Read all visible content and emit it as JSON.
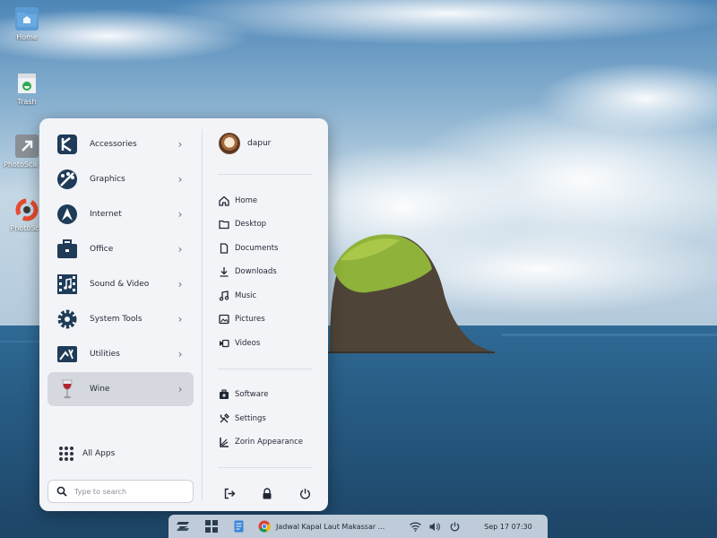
{
  "desktop": {
    "icons": [
      {
        "label": "Home"
      },
      {
        "label": "Trash"
      },
      {
        "label": "PhotoSca inx"
      },
      {
        "label": "PhotoSca"
      }
    ]
  },
  "menu": {
    "categories": [
      {
        "label": "Accessories"
      },
      {
        "label": "Graphics"
      },
      {
        "label": "Internet"
      },
      {
        "label": "Office"
      },
      {
        "label": "Sound & Video"
      },
      {
        "label": "System Tools"
      },
      {
        "label": "Utilities"
      },
      {
        "label": "Wine",
        "selected": true
      }
    ],
    "all_apps_label": "All Apps",
    "search": {
      "placeholder": "Type to search",
      "value": ""
    },
    "user": {
      "name": "dapur"
    },
    "places": [
      {
        "label": "Home",
        "icon": "home-icon"
      },
      {
        "label": "Desktop",
        "icon": "folder-icon"
      },
      {
        "label": "Documents",
        "icon": "document-icon"
      },
      {
        "label": "Downloads",
        "icon": "download-icon"
      },
      {
        "label": "Music",
        "icon": "music-icon"
      },
      {
        "label": "Pictures",
        "icon": "pictures-icon"
      },
      {
        "label": "Videos",
        "icon": "videos-icon"
      }
    ],
    "system": [
      {
        "label": "Software",
        "icon": "software-icon"
      },
      {
        "label": "Settings",
        "icon": "settings-icon"
      },
      {
        "label": "Zorin Appearance",
        "icon": "zorin-appearance-icon"
      }
    ]
  },
  "taskbar": {
    "window_title": "Jadwal Kapal Laut Makassar ...",
    "clock": "Sep 17  07:30"
  },
  "colors": {
    "menu_bg": "#f3f4f8",
    "selected_bg": "#d6d8df",
    "icon_dark": "#1f3b57",
    "text": "#1f2733"
  }
}
